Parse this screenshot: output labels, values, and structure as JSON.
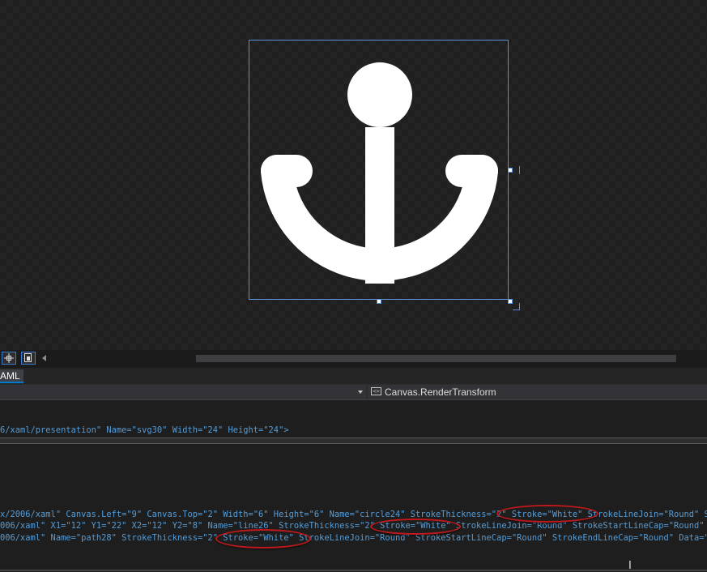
{
  "designer": {
    "canvas_icon": "anchor-icon",
    "icon_color": "#ffffff",
    "selection_color": "#5b8fd8"
  },
  "toolbar": {
    "left_buttons": [
      "crosshair-icon",
      "artboard-icon"
    ],
    "scroll_arrow": "scroll-left-icon"
  },
  "tabs": {
    "xaml_label": "AML"
  },
  "navbar": {
    "left_value": "",
    "right_icon": "code-element-icon",
    "right_value": "Canvas.RenderTransform"
  },
  "code": {
    "line1": "6/xaml/presentation\" Name=\"svg30\" Width=\"24\" Height=\"24\">",
    "line2": "x/2006/xaml\" Canvas.Left=\"9\" Canvas.Top=\"2\" Width=\"6\" Height=\"6\" Name=\"circle24\" StrokeThickness=\"2\" Stroke=\"White\" StrokeLineJoin=\"Round\" St",
    "line3": "006/xaml\" X1=\"12\" Y1=\"22\" X2=\"12\" Y2=\"8\" Name=\"line26\" StrokeThickness=\"2\" Stroke=\"White\" StrokeLineJoin=\"Round\" StrokeStartLineCap=\"Round\" S",
    "line4": "006/xaml\" Name=\"path28\" StrokeThickness=\"2\" Stroke=\"White\" StrokeLineJoin=\"Round\" StrokeStartLineCap=\"Round\" StrokeEndLineCap=\"Round\" Data=\"M"
  },
  "highlight_color": "#c0181b"
}
